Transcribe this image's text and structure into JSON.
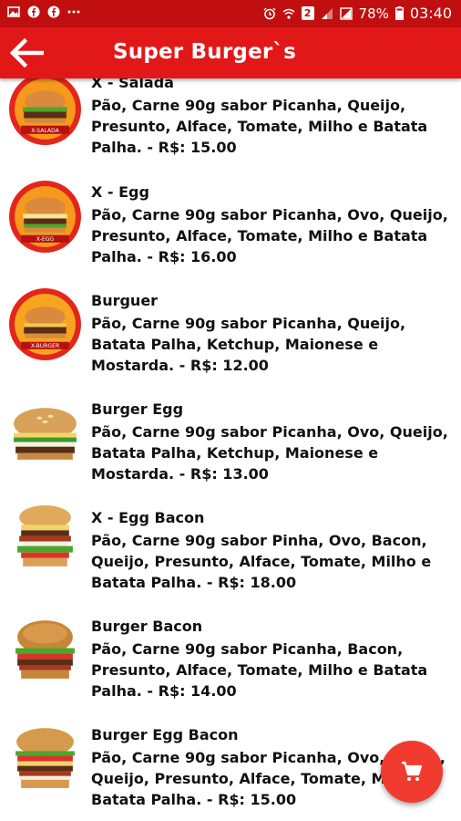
{
  "status_bar": {
    "battery": "78%",
    "time": "03:40",
    "sim_badge": "2"
  },
  "app_bar": {
    "title": "Super Burger`s"
  },
  "menu": {
    "items": [
      {
        "name": "X - Salada",
        "description": "Pão, Carne 90g sabor Picanha, Queijo, Presunto, Alface, Tomate, Milho e Batata Palha. - R$: 15.00",
        "image_label": "X-SALADA"
      },
      {
        "name": "X - Egg",
        "description": "Pão, Carne 90g sabor Picanha, Ovo, Queijo, Presunto, Alface, Tomate, Milho e Batata Palha. - R$: 16.00",
        "image_label": "X-EGG"
      },
      {
        "name": "Burguer",
        "description": "Pão, Carne 90g sabor Picanha, Queijo, Batata Palha, Ketchup, Maionese e Mostarda. - R$: 12.00",
        "image_label": "X-BURGER"
      },
      {
        "name": "Burger Egg",
        "description": "Pão, Carne 90g sabor Picanha, Ovo, Queijo, Batata Palha, Ketchup, Maionese e Mostarda. - R$: 13.00",
        "image_label": ""
      },
      {
        "name": "X - Egg Bacon",
        "description": "Pão, Carne 90g sabor Pinha, Ovo, Bacon, Queijo, Presunto, Alface, Tomate, Milho e Batata Palha. - R$: 18.00",
        "image_label": ""
      },
      {
        "name": "Burger Bacon",
        "description": "Pão, Carne 90g sabor Picanha, Bacon, Presunto, Alface,  Tomate,  Milho  e Batata Palha.  - R$: 14.00",
        "image_label": ""
      },
      {
        "name": "Burger Egg Bacon",
        "description": "Pão, Carne 90g sabor Picanha, Ovo, Bacon, Queijo, Presunto, Alface, Tomate, Milho e Batata Palha.  - R$: 15.00",
        "image_label": ""
      }
    ]
  },
  "fab": {
    "icon": "cart-icon"
  },
  "colors": {
    "app_bar": "#e21818",
    "status_bar": "#c10f0f",
    "fab": "#f03b2e"
  }
}
